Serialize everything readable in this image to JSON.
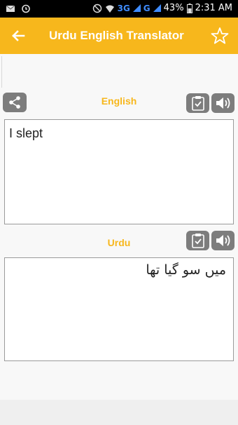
{
  "status_bar": {
    "network_3g": "3G",
    "network_g": "G",
    "battery": "43%",
    "time": "2:31 AM"
  },
  "app_bar": {
    "title": "Urdu English Translator"
  },
  "english": {
    "label": "English",
    "text": "I slept"
  },
  "urdu": {
    "label": "Urdu",
    "text": "میں سو گیا تھا"
  },
  "colors": {
    "accent": "#f7b71c",
    "icon_button": "#7d7d7d"
  }
}
